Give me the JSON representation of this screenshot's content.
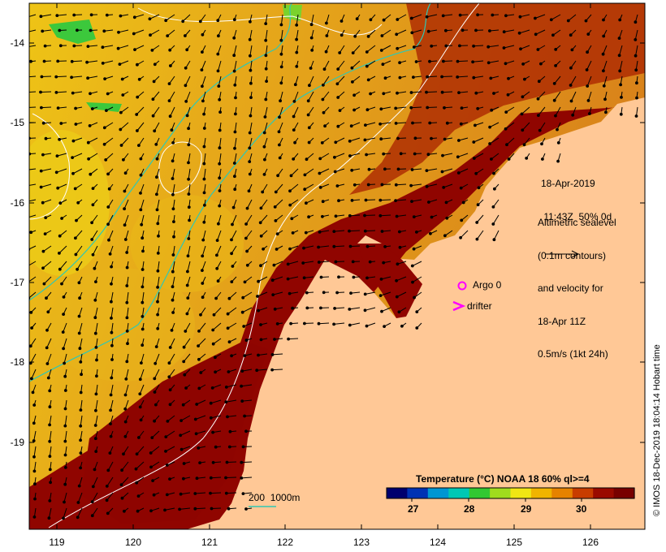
{
  "map": {
    "title_lines": [
      "18-Apr-2019",
      " 11:43Z  50% 0d"
    ],
    "legend_lines": [
      "Altimetric sealevel",
      "(0.1m contours)",
      "and velocity for",
      "18-Apr 11Z",
      "0.5m/s (1kt 24h)"
    ],
    "argo_label": "Argo 0",
    "drifter_label": "drifter",
    "depth_contour_label": "200  1000m",
    "colorbar": {
      "title": "Temperature (°C) NOAA 18 60% ql>=4",
      "ticks": [
        "27",
        "28",
        "29",
        "30"
      ],
      "colors": [
        "#00006e",
        "#0032b4",
        "#0096d2",
        "#00c8b4",
        "#32c832",
        "#a0dc1e",
        "#f0e614",
        "#f0b400",
        "#e68200",
        "#c83c00",
        "#9a0a00",
        "#780000"
      ]
    },
    "lon_ticks": [
      "119",
      "120",
      "121",
      "122",
      "123",
      "124",
      "125",
      "126"
    ],
    "lat_ticks": [
      "-14",
      "-15",
      "-16",
      "-17",
      "-18",
      "-19"
    ],
    "credit": "© IMOS 18-Dec-2019 18:04:14 Hobart time",
    "colors": {
      "land": "#ffc896",
      "warm_sea": "#e29018",
      "cool_sea": "#eec416",
      "coastal_sea": "#900500",
      "bathymetry": "#2fc8b4",
      "sealevel_contour": "#ffffff",
      "argo": "#ff00ff"
    }
  }
}
